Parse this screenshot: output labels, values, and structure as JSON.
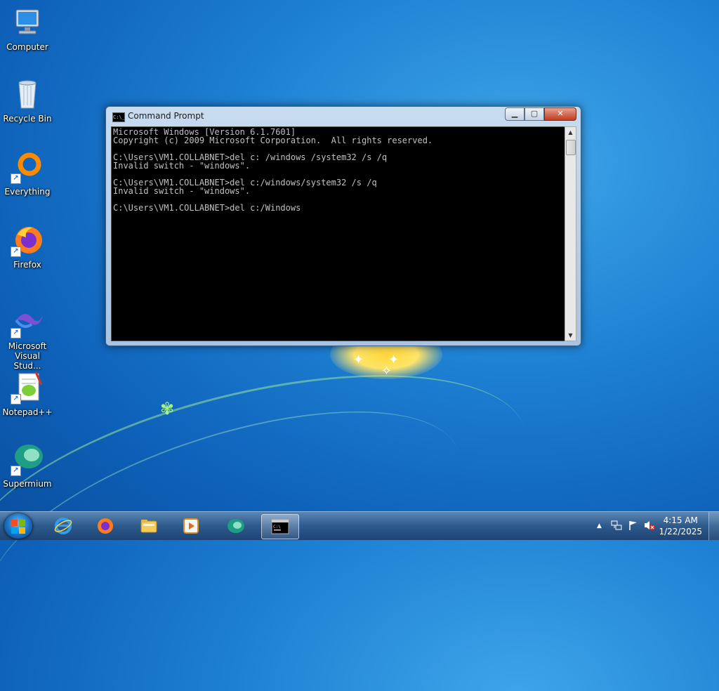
{
  "desktop": {
    "icons": [
      {
        "label": "Computer"
      },
      {
        "label": "Recycle Bin"
      },
      {
        "label": "Everything"
      },
      {
        "label": "Firefox"
      },
      {
        "label": "Microsoft Visual Stud..."
      },
      {
        "label": "Notepad++"
      },
      {
        "label": "Supermium"
      }
    ]
  },
  "cmd": {
    "title": "Command Prompt",
    "minimize": "▁",
    "maximize": "▢",
    "close": "✕",
    "lines": [
      "Microsoft Windows [Version 6.1.7601]",
      "Copyright (c) 2009 Microsoft Corporation.  All rights reserved.",
      "",
      "C:\\Users\\VM1.COLLABNET>del c: /windows /system32 /s /q",
      "Invalid switch - \"windows\".",
      "",
      "C:\\Users\\VM1.COLLABNET>del c:/windows/system32 /s /q",
      "Invalid switch - \"windows\".",
      "",
      "C:\\Users\\VM1.COLLABNET>del c:/Windows"
    ],
    "scroll_up": "▲",
    "scroll_down": "▼"
  },
  "taskbar": {
    "items": [
      {
        "icon": "internet-explorer-icon"
      },
      {
        "icon": "firefox-icon"
      },
      {
        "icon": "file-explorer-icon"
      },
      {
        "icon": "media-player-icon"
      },
      {
        "icon": "supermium-icon"
      },
      {
        "icon": "command-prompt-icon"
      }
    ],
    "tray": {
      "chevron": "▲",
      "time": "4:15 AM",
      "date": "1/22/2025"
    }
  },
  "colors": {
    "console_bg": "#000000",
    "console_text": "#c0c0c0",
    "close_button": "#c23c22"
  }
}
